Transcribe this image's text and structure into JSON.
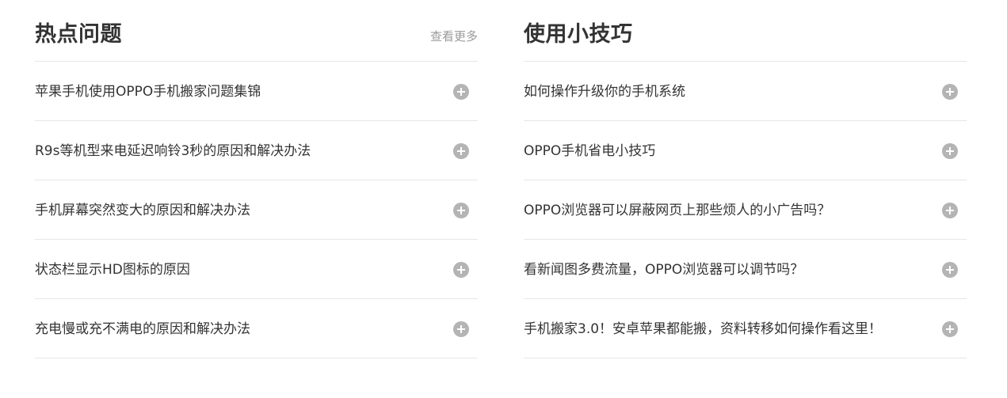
{
  "hot": {
    "title": "热点问题",
    "more_label": "查看更多",
    "items": [
      "苹果手机使用OPPO手机搬家问题集锦",
      "R9s等机型来电延迟响铃3秒的原因和解决办法",
      "手机屏幕突然变大的原因和解决办法",
      "状态栏显示HD图标的原因",
      "充电慢或充不满电的原因和解决办法"
    ]
  },
  "tips": {
    "title": "使用小技巧",
    "items": [
      "如何操作升级你的手机系统",
      "OPPO手机省电小技巧",
      "OPPO浏览器可以屏蔽网页上那些烦人的小广告吗？",
      "看新闻图多费流量，OPPO浏览器可以调节吗？",
      "手机搬家3.0！安卓苹果都能搬，资料转移如何操作看这里！"
    ]
  },
  "icons": {
    "expand": "plus-circle-icon"
  },
  "colors": {
    "text": "#333333",
    "muted": "#9a9a9a",
    "divider": "#e6e6e6",
    "icon": "#b4b4b4"
  }
}
